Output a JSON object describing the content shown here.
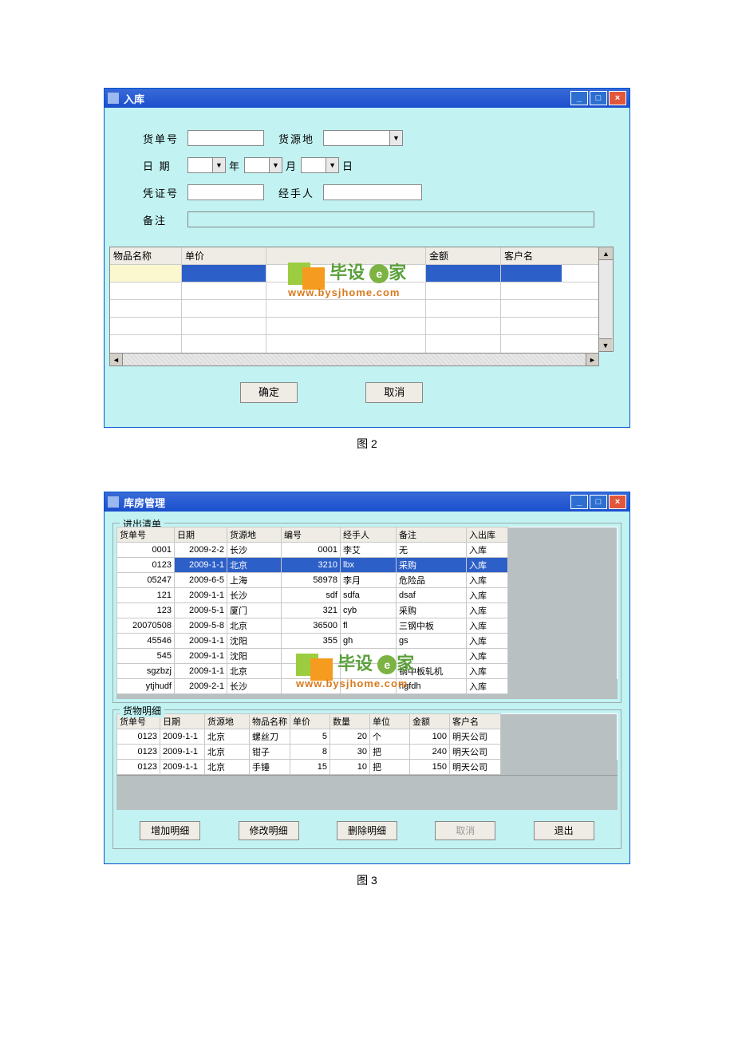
{
  "win1": {
    "title": "入库",
    "labels": {
      "order_no": "货单号",
      "source": "货源地",
      "date": "日 期",
      "year": "年",
      "month": "月",
      "day": "日",
      "voucher": "凭证号",
      "handler": "经手人",
      "remark": "备注"
    },
    "grid_headers": {
      "name": "物品名称",
      "price": "单价",
      "amount": "金额",
      "customer": "客户名"
    },
    "buttons": {
      "ok": "确定",
      "cancel": "取消"
    }
  },
  "caption1": "图 2",
  "win2": {
    "title": "库房管理",
    "fs1": "进出清单",
    "fs2": "货物明细",
    "list_headers": {
      "order_no": "货单号",
      "date": "日期",
      "source": "货源地",
      "code": "编号",
      "handler": "经手人",
      "remark": "备注",
      "inout": "入出库"
    },
    "list_rows": [
      {
        "order_no": "0001",
        "date": "2009-2-2",
        "source": "长沙",
        "code": "0001",
        "handler": "李艾",
        "remark": "无",
        "inout": "入库"
      },
      {
        "order_no": "0123",
        "date": "2009-1-1",
        "source": "北京",
        "code": "3210",
        "handler": "lbx",
        "remark": "采购",
        "inout": "入库"
      },
      {
        "order_no": "05247",
        "date": "2009-6-5",
        "source": "上海",
        "code": "58978",
        "handler": "李月",
        "remark": "危险品",
        "inout": "入库"
      },
      {
        "order_no": "121",
        "date": "2009-1-1",
        "source": "长沙",
        "code": "sdf",
        "handler": "sdfa",
        "remark": "dsaf",
        "inout": "入库"
      },
      {
        "order_no": "123",
        "date": "2009-5-1",
        "source": "厦门",
        "code": "321",
        "handler": "cyb",
        "remark": "采购",
        "inout": "入库"
      },
      {
        "order_no": "20070508",
        "date": "2009-5-8",
        "source": "北京",
        "code": "36500",
        "handler": "fl",
        "remark": "三钢中板",
        "inout": "入库"
      },
      {
        "order_no": "45546",
        "date": "2009-1-1",
        "source": "沈阳",
        "code": "355",
        "handler": "gh",
        "remark": "gs",
        "inout": "入库"
      },
      {
        "order_no": "545",
        "date": "2009-1-1",
        "source": "沈阳",
        "code": "",
        "handler": "",
        "remark": "",
        "inout": "入库"
      },
      {
        "order_no": "sgzbzj",
        "date": "2009-1-1",
        "source": "北京",
        "code": "",
        "handler": "",
        "remark": "钢中板轧机",
        "inout": "入库"
      },
      {
        "order_no": "ytjhudf",
        "date": "2009-2-1",
        "source": "长沙",
        "code": "",
        "handler": "",
        "remark": "hgfdh",
        "inout": "入库"
      }
    ],
    "detail_headers": {
      "order_no": "货单号",
      "date": "日期",
      "source": "货源地",
      "item": "物品名称",
      "price": "单价",
      "qty": "数量",
      "unit": "单位",
      "amount": "金额",
      "customer": "客户名"
    },
    "detail_rows": [
      {
        "order_no": "0123",
        "date": "2009-1-1",
        "source": "北京",
        "item": "螺丝刀",
        "price": "5",
        "qty": "20",
        "unit": "个",
        "amount": "100",
        "customer": "明天公司"
      },
      {
        "order_no": "0123",
        "date": "2009-1-1",
        "source": "北京",
        "item": "钳子",
        "price": "8",
        "qty": "30",
        "unit": "把",
        "amount": "240",
        "customer": "明天公司"
      },
      {
        "order_no": "0123",
        "date": "2009-1-1",
        "source": "北京",
        "item": "手锤",
        "price": "15",
        "qty": "10",
        "unit": "把",
        "amount": "150",
        "customer": "明天公司"
      }
    ],
    "buttons": {
      "add": "增加明细",
      "edit": "修改明细",
      "del": "删除明细",
      "cancel": "取消",
      "exit": "退出"
    }
  },
  "caption2": "图 3",
  "watermark": {
    "text1": "毕设",
    "text2": "家",
    "url": "www.bysjhome.com"
  }
}
